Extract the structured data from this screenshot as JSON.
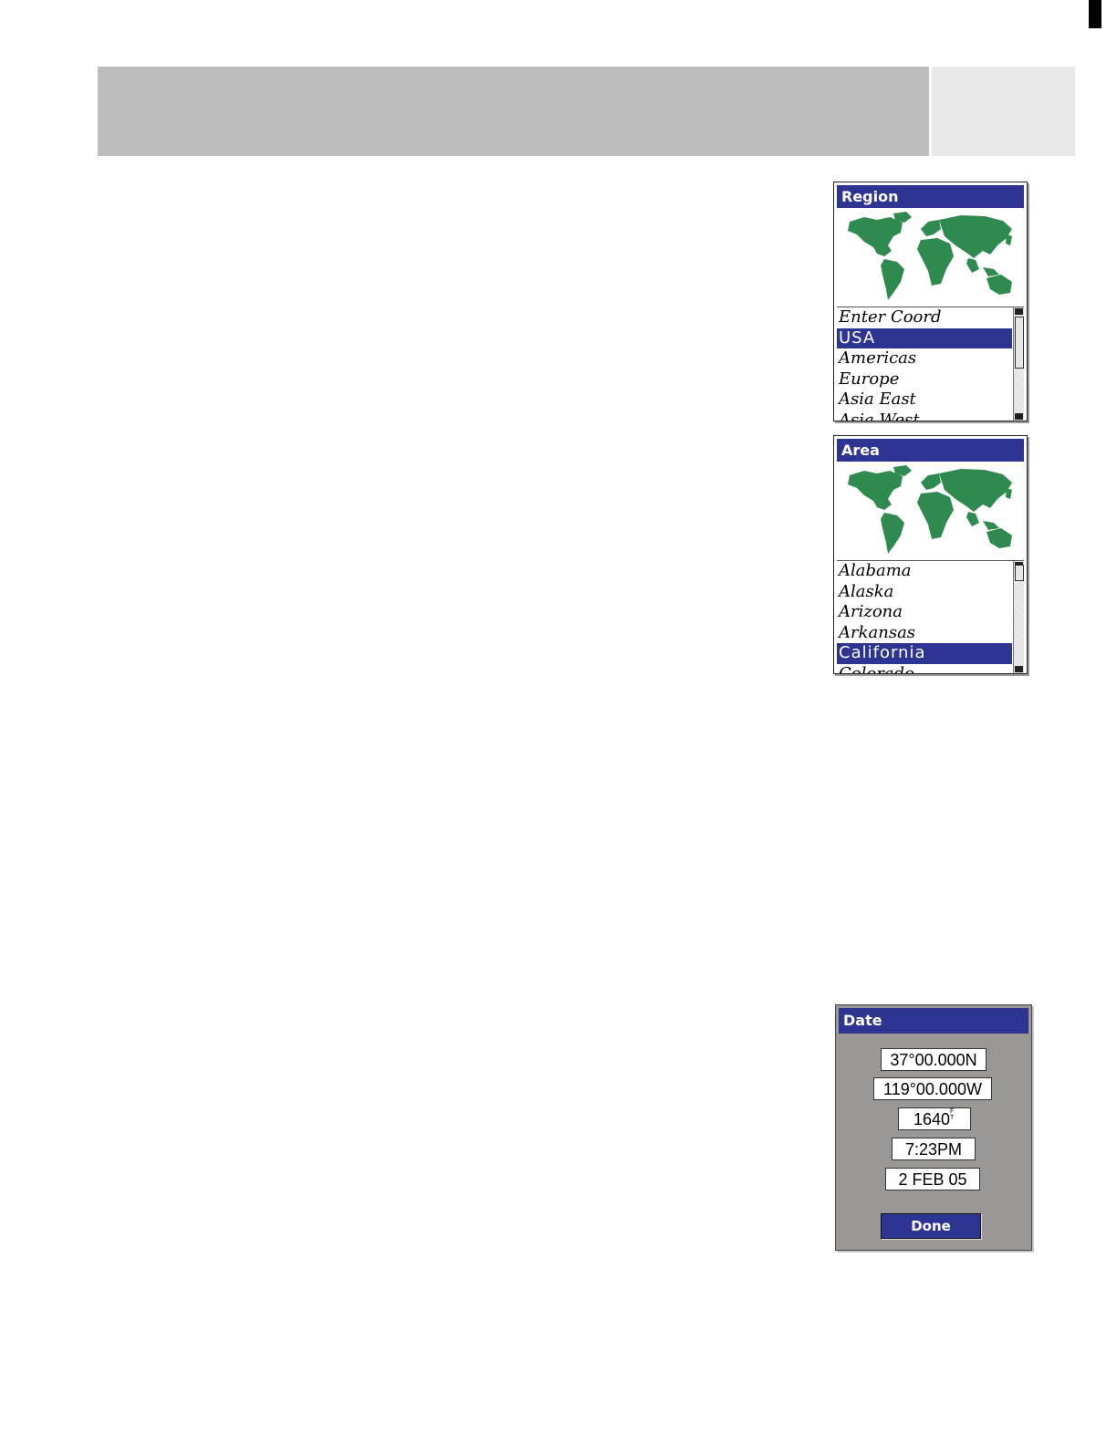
{
  "region_panel": {
    "title": "Region",
    "items": [
      {
        "label": "Enter Coord",
        "selected": false
      },
      {
        "label": "USA",
        "selected": true
      },
      {
        "label": "Americas",
        "selected": false
      },
      {
        "label": "Europe",
        "selected": false
      },
      {
        "label": "Asia East",
        "selected": false
      },
      {
        "label": "Asia West",
        "selected": false
      }
    ]
  },
  "area_panel": {
    "title": "Area",
    "items": [
      {
        "label": "Alabama",
        "selected": false
      },
      {
        "label": "Alaska",
        "selected": false
      },
      {
        "label": "Arizona",
        "selected": false
      },
      {
        "label": "Arkansas",
        "selected": false
      },
      {
        "label": "California",
        "selected": true
      },
      {
        "label": "Colorado",
        "selected": false
      }
    ]
  },
  "date_panel": {
    "title": "Date",
    "latitude": "37°00.000N",
    "longitude": "119°00.000W",
    "elevation": "1640",
    "elevation_unit_top": "F",
    "elevation_unit_bottom": "T",
    "time": "7:23PM",
    "date": "2 FEB 05",
    "done_label": "Done"
  },
  "colors": {
    "titlebar": "#2d3492",
    "land": "#2f8a4f",
    "header_gray": "#bdbdbd",
    "dialog_gray": "#9b9794"
  }
}
